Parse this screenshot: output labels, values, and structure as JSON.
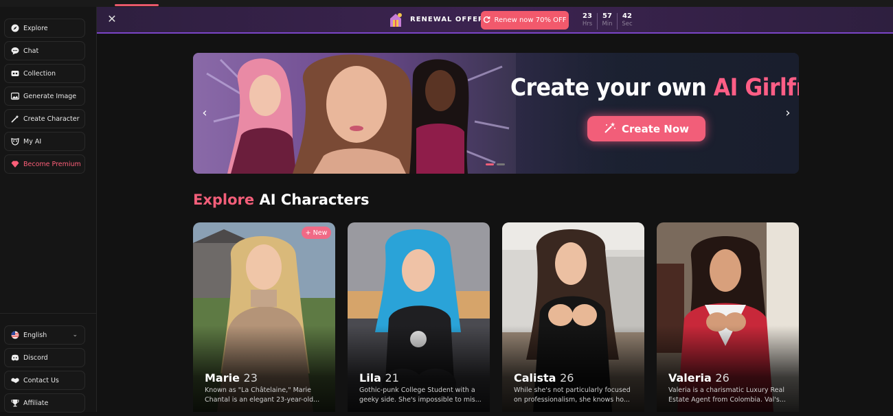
{
  "sidebar": {
    "items": [
      {
        "label": "Explore",
        "icon": "compass-icon"
      },
      {
        "label": "Chat",
        "icon": "chat-bubble-icon"
      },
      {
        "label": "Collection",
        "icon": "collection-icon"
      },
      {
        "label": "Generate Image",
        "icon": "image-icon"
      },
      {
        "label": "Create Character",
        "icon": "magic-wand-icon"
      },
      {
        "label": "My AI",
        "icon": "mask-icon"
      },
      {
        "label": "Become Premium",
        "icon": "diamond-icon",
        "color": "#ff5f79"
      }
    ],
    "bottom": {
      "language": "English",
      "discord": "Discord",
      "contact": "Contact Us",
      "affiliate": "Affiliate"
    }
  },
  "renewal": {
    "label": "RENEWAL OFFER",
    "button": "Renew now 70% OFF",
    "timer": {
      "hours": "23",
      "hours_label": "Hrs",
      "minutes": "57",
      "minutes_label": "Min",
      "seconds": "42",
      "seconds_label": "Sec"
    }
  },
  "banner": {
    "title_prefix": "Create your own ",
    "title_highlight": "AI Girlfriend",
    "button": "Create Now"
  },
  "section": {
    "title_highlight": "Explore",
    "title_rest": " AI Characters"
  },
  "characters": [
    {
      "name": "Marie",
      "age": "23",
      "badge": "+ New",
      "description": "Known as \"La Châtelaine,\" Marie Chantal is an elegant 23-year-old..."
    },
    {
      "name": "Lila",
      "age": "21",
      "description": "Gothic-punk College Student with a geeky side. She's impossible to mis..."
    },
    {
      "name": "Calista",
      "age": "26",
      "description": "While she's not particularly focused on professionalism, she knows ho..."
    },
    {
      "name": "Valeria",
      "age": "26",
      "description": "Valeria is a charismatic Luxury Real Estate Agent from Colombia. Val's..."
    }
  ],
  "colors": {
    "accent": "#f25e79",
    "background": "#121212",
    "renewal_bar": "#3c2350"
  }
}
